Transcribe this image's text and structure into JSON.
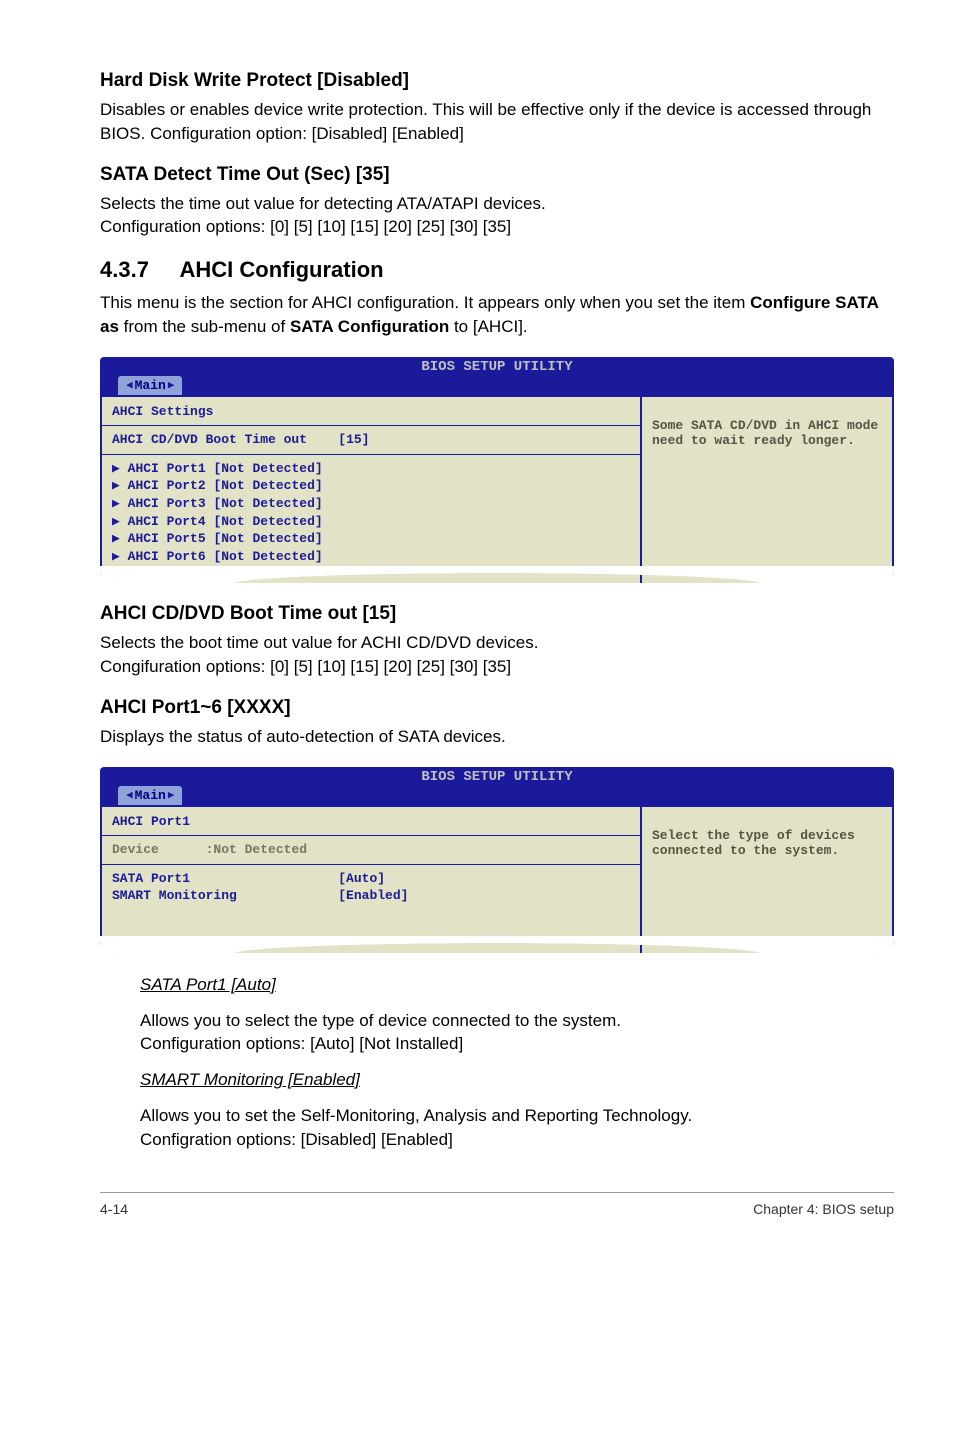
{
  "section1": {
    "h": "Hard Disk Write Protect [Disabled]",
    "p": "Disables or enables device write protection. This will be effective only if the device is accessed through BIOS. Configuration option: [Disabled] [Enabled]"
  },
  "section2": {
    "h": "SATA Detect Time Out (Sec) [35]",
    "p1": "Selects the time out value for detecting ATA/ATAPI devices.",
    "p2": "Configuration options: [0] [5] [10] [15] [20] [25] [30] [35]"
  },
  "section3": {
    "num": "4.3.7",
    "title": "AHCI Configuration",
    "p": "This menu is the section for AHCI configuration. It appears only when you set the item ",
    "bold1": "Configure SATA as",
    "mid": " from the sub-menu of ",
    "bold2": "SATA Configuration",
    "end": " to [AHCI]."
  },
  "bios1": {
    "title": "BIOS SETUP UTILITY",
    "tab": "Main",
    "heading": "AHCI Settings",
    "row1_label": "AHCI CD/DVD Boot Time out",
    "row1_val": "[15]",
    "ports": [
      "AHCI Port1 [Not Detected]",
      "AHCI Port2 [Not Detected]",
      "AHCI Port3 [Not Detected]",
      "AHCI Port4 [Not Detected]",
      "AHCI Port5 [Not Detected]",
      "AHCI Port6 [Not Detected]"
    ],
    "help": "Some SATA CD/DVD in AHCI mode need to wait ready longer."
  },
  "section4": {
    "h": "AHCI CD/DVD Boot Time out [15]",
    "p1": "Selects the boot time out value for ACHI CD/DVD devices.",
    "p2": "Congifuration options: [0] [5] [10] [15] [20] [25] [30] [35]"
  },
  "section5": {
    "h": "AHCI Port1~6 [XXXX]",
    "p": "Displays the status of auto-detection of SATA devices."
  },
  "bios2": {
    "title": "BIOS SETUP UTILITY",
    "tab": "Main",
    "heading": "AHCI Port1",
    "device_label": "Device",
    "device_val": ":Not Detected",
    "row1_label": "SATA Port1",
    "row1_val": "[Auto]",
    "row2_label": "SMART Monitoring",
    "row2_val": "[Enabled]",
    "help": "Select the type of devices connected to the system."
  },
  "sub1": {
    "h": "SATA Port1 [Auto]",
    "p1": "Allows you to select the type of device connected to the system.",
    "p2": "Configuration options: [Auto] [Not Installed]"
  },
  "sub2": {
    "h": "SMART Monitoring [Enabled]",
    "p1": "Allows you to set the Self-Monitoring, Analysis and Reporting Technology.",
    "p2": "Configration options: [Disabled] [Enabled]"
  },
  "footer": {
    "left": "4-14",
    "right": "Chapter 4: BIOS setup"
  }
}
